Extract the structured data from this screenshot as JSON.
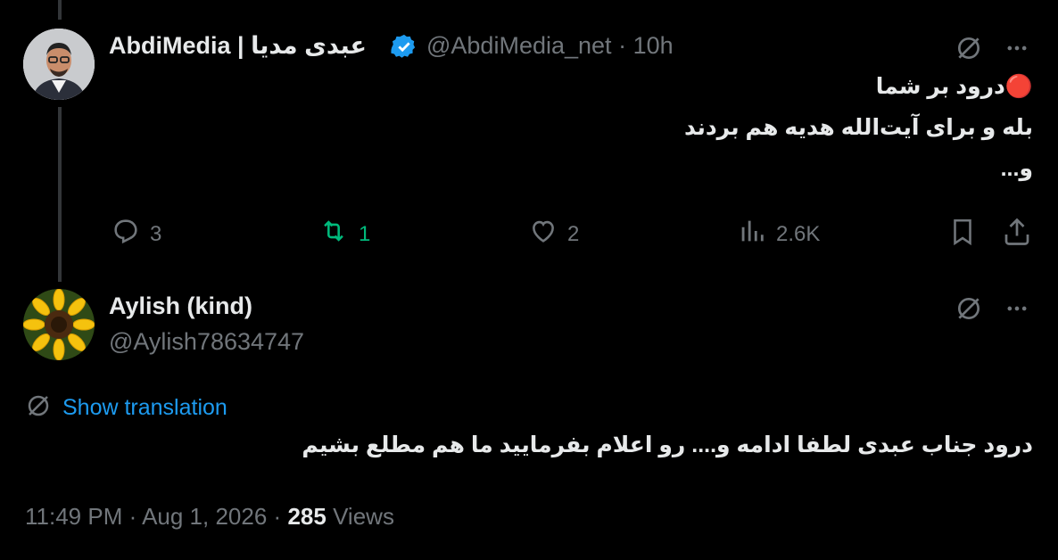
{
  "tweet": {
    "name_en": "AbdiMedia | ",
    "name_fa": "عبدی مدیا",
    "handle": "@AbdiMedia_net",
    "separator": "·",
    "time": "10h",
    "text": [
      "درود بر شما",
      "بله و برای آیت‌الله هدیه هم بردند",
      "و..."
    ],
    "emoji": "🔴",
    "stats": {
      "replies": "3",
      "retweets": "1",
      "likes": "2",
      "views": "2.6K"
    }
  },
  "reply": {
    "name": "Aylish (kind)",
    "handle": "@Aylish78634747",
    "translate_label": "Show translation",
    "text": "درود جناب عبدی  لطفا  ادامه و.... رو اعلام بفرمایید  ما هم مطلع بشیم",
    "time": "11:49 PM",
    "date": "Aug 1, 2026",
    "views_count": "285",
    "views_label": "Views",
    "separator": "·"
  },
  "colors": {
    "accent": "#1d9bf0",
    "retweet": "#00ba7c",
    "muted": "#71767b",
    "text": "#e7e9ea"
  },
  "icons": [
    "verified-badge-icon",
    "grok-icon",
    "more-icon",
    "reply-icon",
    "retweet-icon",
    "like-icon",
    "views-icon",
    "bookmark-icon",
    "share-icon",
    "translate-icon"
  ]
}
